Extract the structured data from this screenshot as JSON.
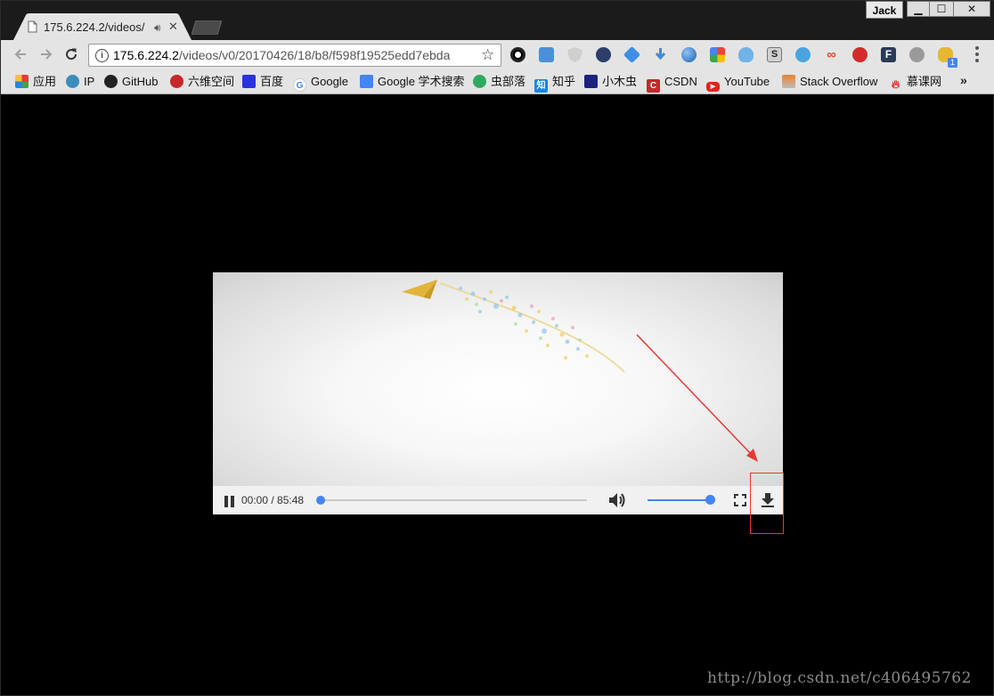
{
  "browser": {
    "profile_name": "Jack",
    "window_buttons": {
      "minimize": "▁",
      "maximize": "☐",
      "close": "✕"
    },
    "tab": {
      "title": "175.6.224.2/videos/"
    },
    "url": {
      "host": "175.6.224.2",
      "path": "/videos/v0/20170426/18/b8/f598f19525edd7ebda"
    },
    "bookmarks_more": "»",
    "bookmarks": [
      {
        "label": "应用",
        "icon": "apps-grid-icon"
      },
      {
        "label": "IP",
        "icon": "ip-icon"
      },
      {
        "label": "GitHub",
        "icon": "github-icon"
      },
      {
        "label": "六维空间",
        "icon": "liuwei-icon"
      },
      {
        "label": "百度",
        "icon": "baidu-icon"
      },
      {
        "label": "Google",
        "icon": "google-icon"
      },
      {
        "label": "Google 学术搜索",
        "icon": "google-scholar-icon"
      },
      {
        "label": "虫部落",
        "icon": "chongbuluo-icon"
      },
      {
        "label": "知乎",
        "icon": "zhihu-icon"
      },
      {
        "label": "小木虫",
        "icon": "xiaomuchong-icon"
      },
      {
        "label": "CSDN",
        "icon": "csdn-icon"
      },
      {
        "label": "YouTube",
        "icon": "youtube-icon"
      },
      {
        "label": "Stack Overflow",
        "icon": "stackoverflow-icon"
      },
      {
        "label": "慕课网",
        "icon": "imooc-icon"
      }
    ],
    "extension_badge": "1"
  },
  "video": {
    "time_display": "00:00 / 85:48",
    "progress_fraction": 0.0,
    "volume_fraction": 1.0
  },
  "watermark": "http://blog.csdn.net/c406495762",
  "colors": {
    "accent": "#4285f4",
    "annotation": "#e53935"
  }
}
